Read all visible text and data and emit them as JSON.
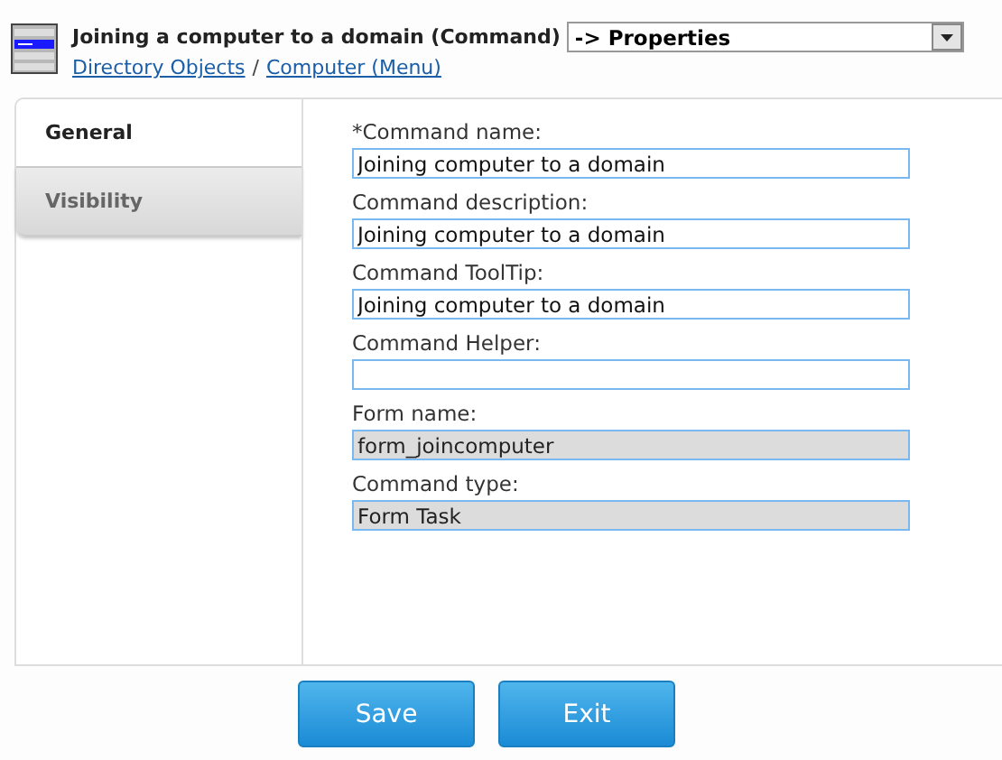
{
  "header": {
    "title": "Joining a computer to a domain (Command)",
    "view_select": {
      "value": "-> Properties"
    },
    "breadcrumb": [
      "Directory Objects",
      "Computer (Menu)"
    ],
    "breadcrumb_separator": "/"
  },
  "tabs": [
    {
      "label": "General",
      "selected": true
    },
    {
      "label": "Visibility",
      "selected": false
    }
  ],
  "fields": [
    {
      "label": "*Command name:",
      "value": "Joining computer to a domain",
      "disabled": false
    },
    {
      "label": "Command description:",
      "value": "Joining computer to a domain",
      "disabled": false
    },
    {
      "label": "Command ToolTip:",
      "value": "Joining computer to a domain",
      "disabled": false
    },
    {
      "label": "Command Helper:",
      "disabled": false
    },
    {
      "label": "Form name:",
      "value": "form_joincomputer",
      "disabled": true
    },
    {
      "label": "Command type:",
      "value": "Form Task",
      "disabled": true
    }
  ],
  "buttons": [
    "Save",
    "Exit"
  ]
}
